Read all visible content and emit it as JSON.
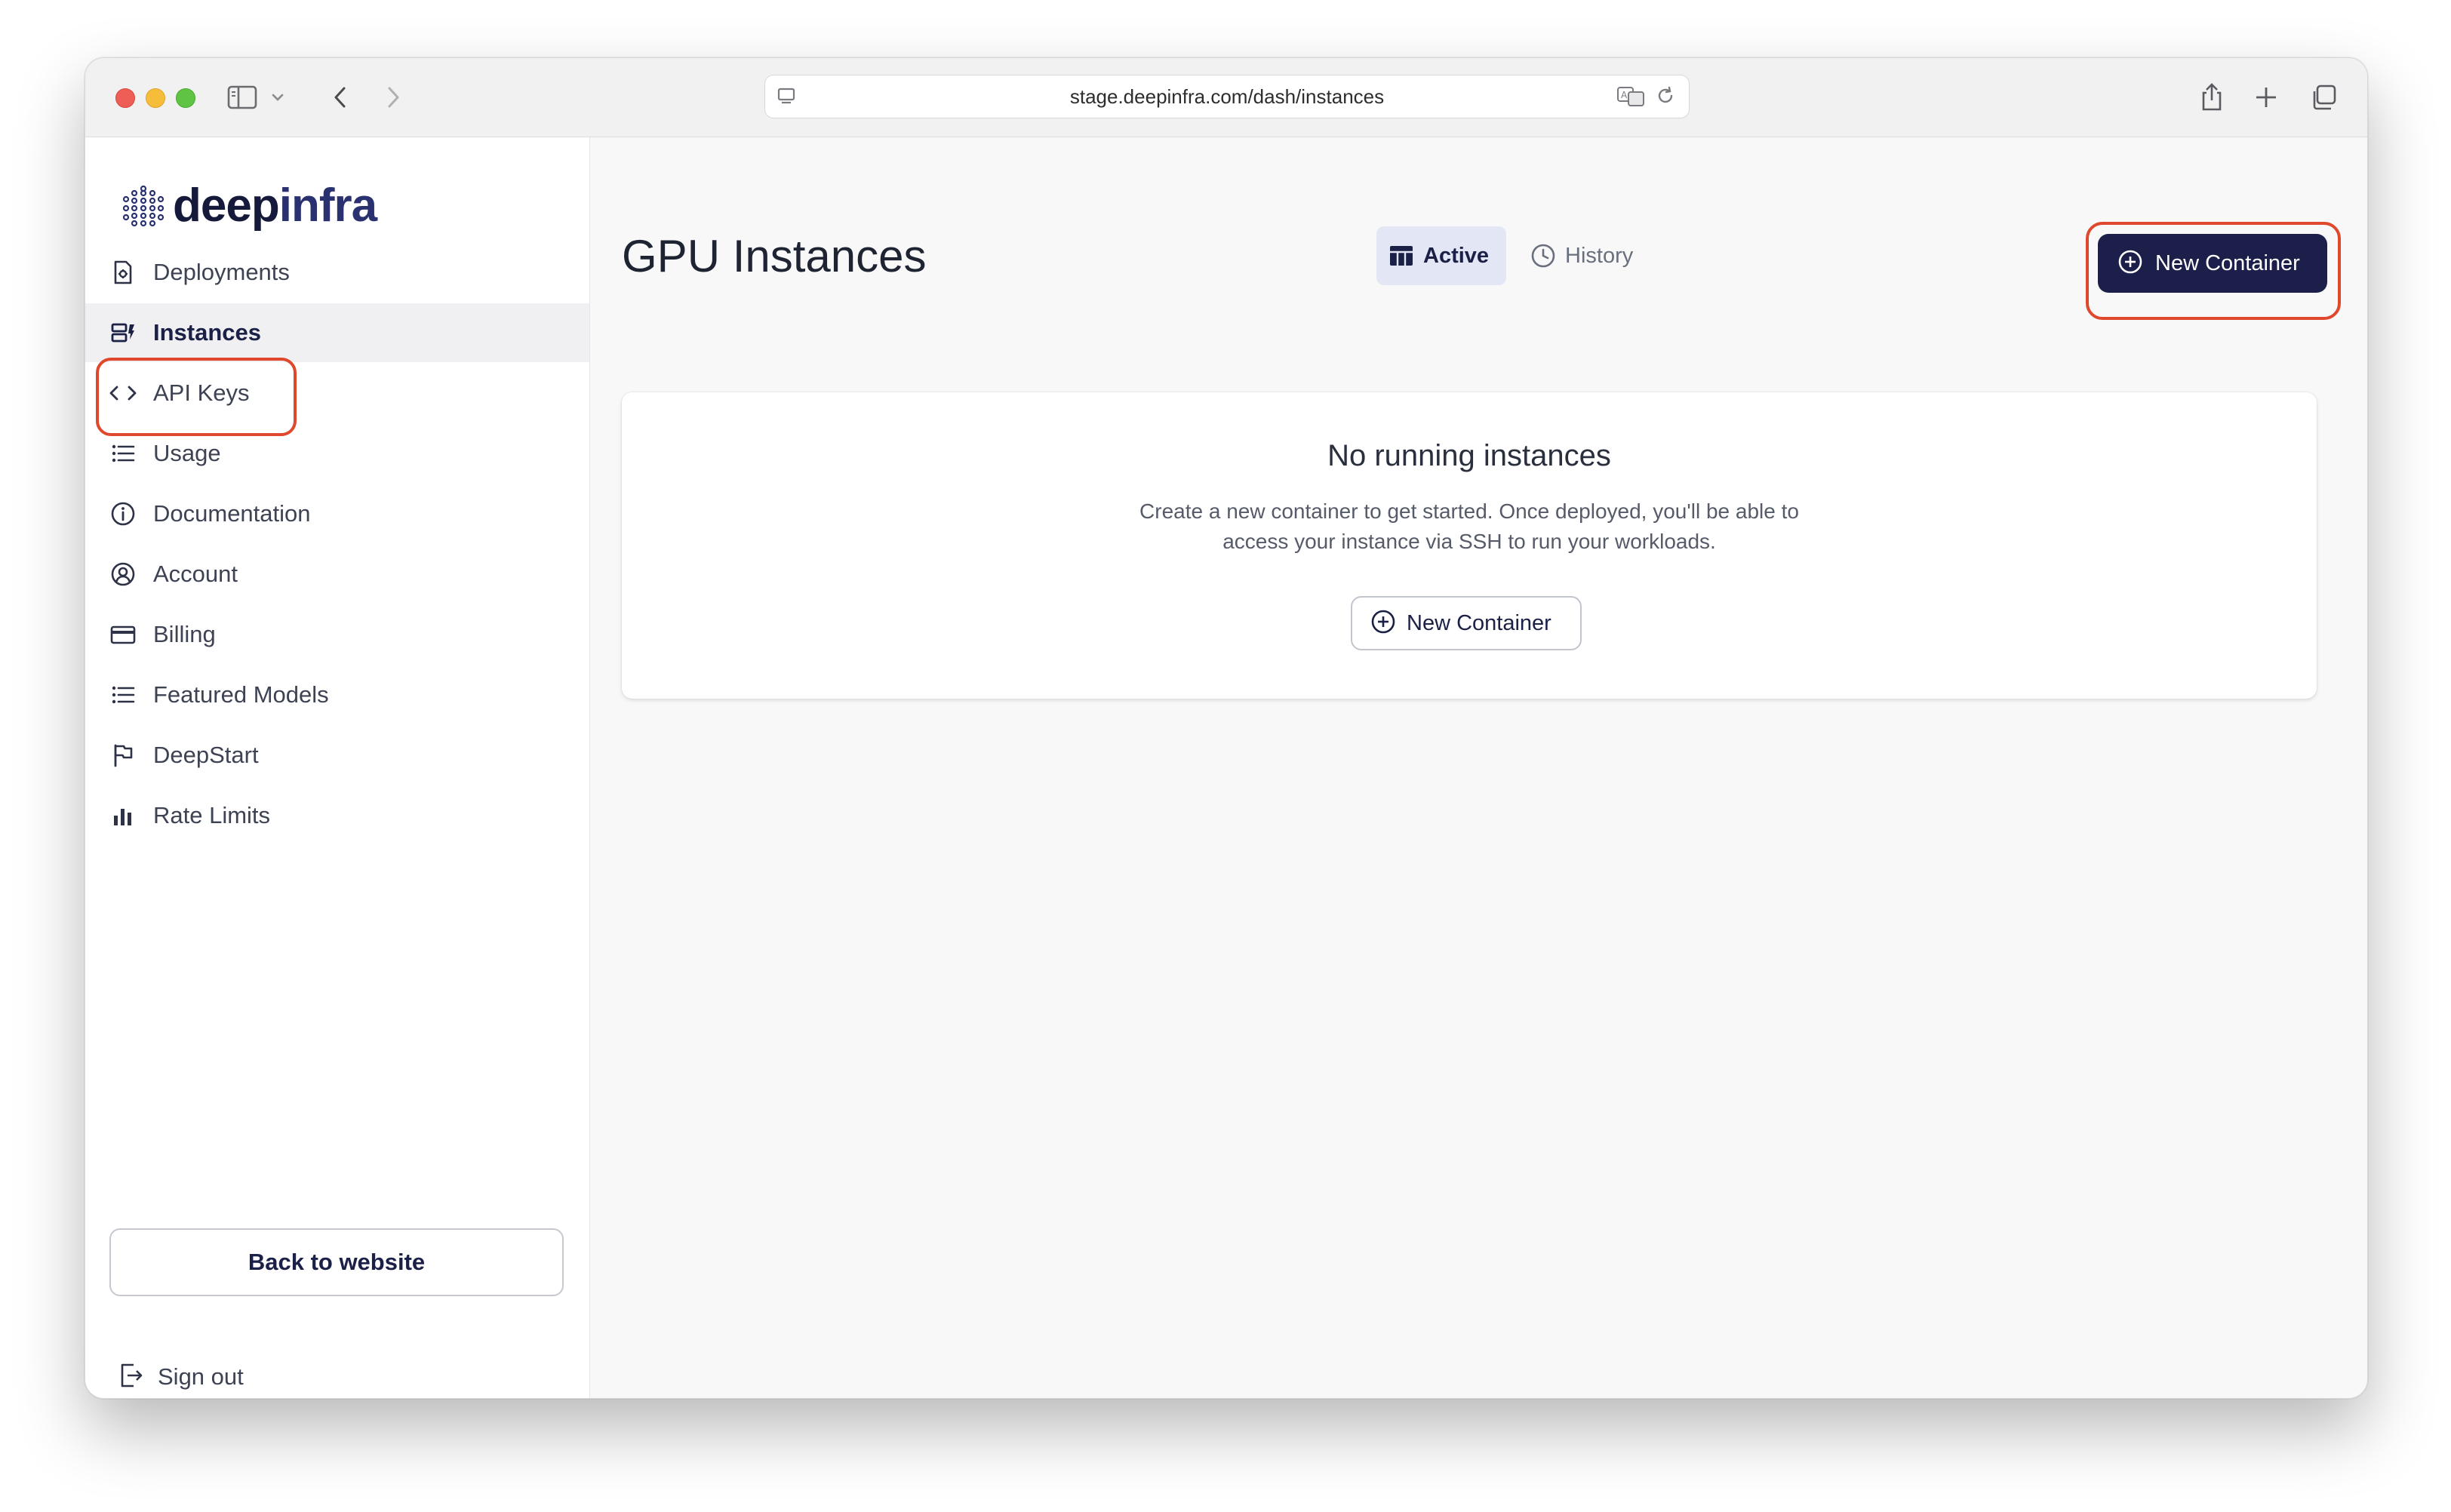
{
  "browser": {
    "url": "stage.deepinfra.com/dash/instances"
  },
  "logo": {
    "part1": "deep",
    "part2": "infra"
  },
  "sidebar": {
    "items": [
      {
        "label": "Deployments",
        "icon": "deployments-icon"
      },
      {
        "label": "Instances",
        "icon": "instances-icon",
        "active": true
      },
      {
        "label": "API Keys",
        "icon": "code-icon"
      },
      {
        "label": "Usage",
        "icon": "list-icon"
      },
      {
        "label": "Documentation",
        "icon": "info-icon"
      },
      {
        "label": "Account",
        "icon": "user-circle-icon"
      },
      {
        "label": "Billing",
        "icon": "credit-card-icon"
      },
      {
        "label": "Featured Models",
        "icon": "list-icon"
      },
      {
        "label": "DeepStart",
        "icon": "flag-icon"
      },
      {
        "label": "Rate Limits",
        "icon": "bar-chart-icon"
      }
    ],
    "back_label": "Back to website",
    "signout_label": "Sign out"
  },
  "main": {
    "title": "GPU Instances",
    "tabs": [
      {
        "label": "Active",
        "active": true
      },
      {
        "label": "History",
        "active": false
      }
    ],
    "new_container_label": "New Container",
    "empty": {
      "title": "No running instances",
      "line1": "Create a new container to get started. Once deployed, you'll be able to",
      "line2": "access your instance via SSH to run your workloads.",
      "button_label": "New Container"
    }
  },
  "colors": {
    "primary": "#1c1f4a",
    "highlight": "#e0482d",
    "active_tab_bg": "#e3e7f5"
  }
}
